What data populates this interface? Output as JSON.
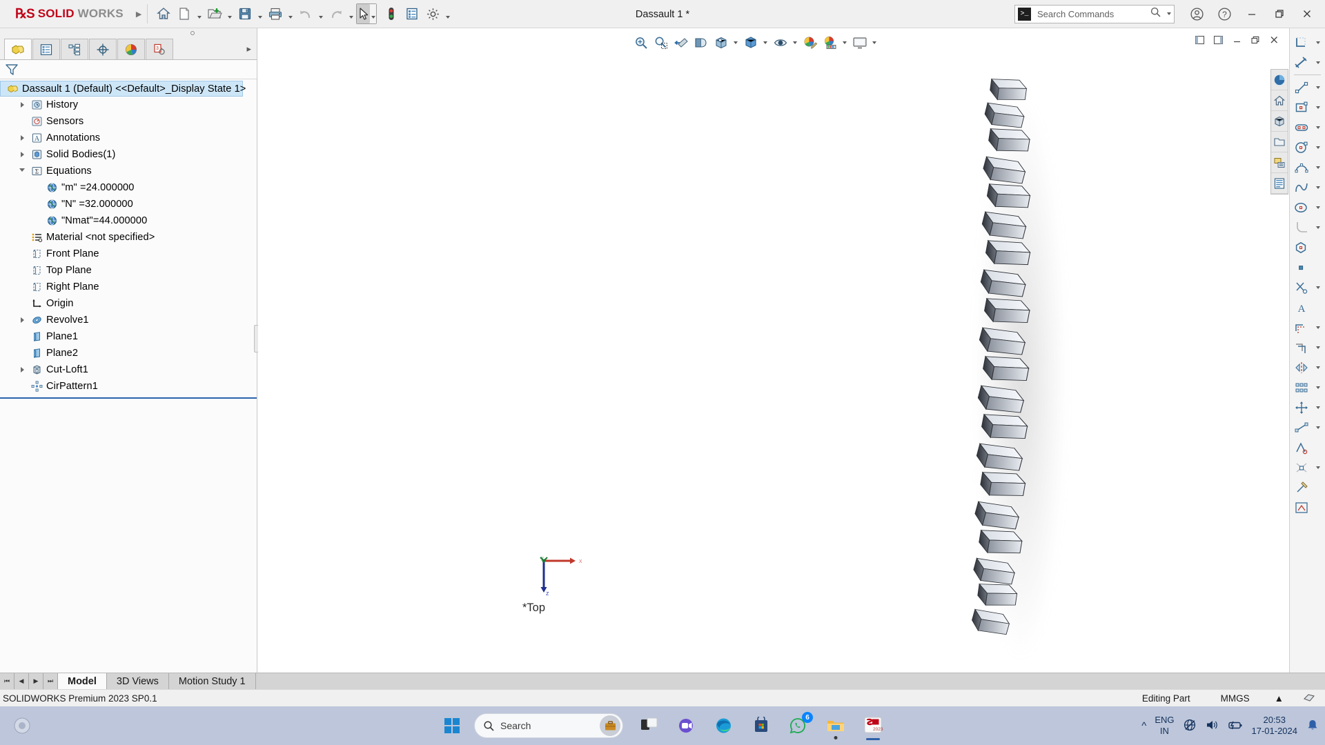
{
  "app": {
    "brand_ds": "2S",
    "brand_solid": "SOLID",
    "brand_works": "WORKS",
    "document_title": "Dassault 1 *",
    "version_text": "SOLIDWORKS Premium 2023 SP0.1"
  },
  "titlebar": {
    "buttons": [
      {
        "name": "home-button",
        "label": "Home"
      },
      {
        "name": "new-document-button",
        "label": "New"
      },
      {
        "name": "open-document-button",
        "label": "Open"
      },
      {
        "name": "save-button",
        "label": "Save"
      },
      {
        "name": "print-button",
        "label": "Print"
      },
      {
        "name": "undo-button",
        "label": "Undo"
      },
      {
        "name": "redo-button",
        "label": "Redo"
      },
      {
        "name": "select-button",
        "label": "Select"
      },
      {
        "name": "rebuild-button",
        "label": "Rebuild"
      },
      {
        "name": "file-properties-button",
        "label": "File Properties"
      },
      {
        "name": "options-button",
        "label": "Options"
      }
    ],
    "search": {
      "placeholder": "Search Commands",
      "value": "Search Commands"
    },
    "window_controls": {
      "account_label": "Account",
      "help_label": "Help",
      "minimize_label": "Minimize",
      "restore_label": "Restore",
      "close_label": "Close"
    }
  },
  "panel": {
    "tabs": [
      {
        "name": "feature-manager-tab",
        "label": "FeatureManager Design Tree",
        "selected": true
      },
      {
        "name": "property-manager-tab",
        "label": "PropertyManager",
        "selected": false
      },
      {
        "name": "configuration-manager-tab",
        "label": "ConfigurationManager",
        "selected": false
      },
      {
        "name": "dimxpert-manager-tab",
        "label": "DimXpertManager",
        "selected": false
      },
      {
        "name": "display-manager-tab",
        "label": "DisplayManager",
        "selected": false
      },
      {
        "name": "cam-feature-tree-tab",
        "label": "CAM Feature Tree",
        "selected": false
      }
    ],
    "filter_placeholder": "Filter",
    "tree": [
      {
        "label": "Dassault 1 (Default) <<Default>_Display State 1>",
        "icon": "part-icon",
        "indent": 0,
        "arrow": "none",
        "selected": true
      },
      {
        "label": "History",
        "icon": "history-icon",
        "indent": 1,
        "arrow": "collapsed",
        "selected": false
      },
      {
        "label": "Sensors",
        "icon": "sensors-icon",
        "indent": 1,
        "arrow": "none",
        "selected": false
      },
      {
        "label": "Annotations",
        "icon": "annotations-icon",
        "indent": 1,
        "arrow": "collapsed",
        "selected": false
      },
      {
        "label": "Solid Bodies(1)",
        "icon": "solid-bodies-icon",
        "indent": 1,
        "arrow": "collapsed",
        "selected": false
      },
      {
        "label": "Equations",
        "icon": "equations-icon",
        "indent": 1,
        "arrow": "expanded",
        "selected": false
      },
      {
        "label": "\"m\" =24.000000",
        "icon": "global-variable-icon",
        "indent": 2,
        "arrow": "none",
        "selected": false
      },
      {
        "label": "\"N\" =32.000000",
        "icon": "global-variable-icon",
        "indent": 2,
        "arrow": "none",
        "selected": false
      },
      {
        "label": "\"Nmat\"=44.000000",
        "icon": "global-variable-icon",
        "indent": 2,
        "arrow": "none",
        "selected": false
      },
      {
        "label": "Material <not specified>",
        "icon": "material-icon",
        "indent": 1,
        "arrow": "none",
        "selected": false
      },
      {
        "label": "Front Plane",
        "icon": "plane-icon",
        "indent": 1,
        "arrow": "none",
        "selected": false
      },
      {
        "label": "Top Plane",
        "icon": "plane-icon",
        "indent": 1,
        "arrow": "none",
        "selected": false
      },
      {
        "label": "Right Plane",
        "icon": "plane-icon",
        "indent": 1,
        "arrow": "none",
        "selected": false
      },
      {
        "label": "Origin",
        "icon": "origin-icon",
        "indent": 1,
        "arrow": "none",
        "selected": false
      },
      {
        "label": "Revolve1",
        "icon": "revolve-icon",
        "indent": 1,
        "arrow": "collapsed",
        "selected": false
      },
      {
        "label": "Plane1",
        "icon": "plane-blue-icon",
        "indent": 1,
        "arrow": "none",
        "selected": false
      },
      {
        "label": "Plane2",
        "icon": "plane-blue-icon",
        "indent": 1,
        "arrow": "none",
        "selected": false
      },
      {
        "label": "Cut-Loft1",
        "icon": "cut-loft-icon",
        "indent": 1,
        "arrow": "collapsed",
        "selected": false
      },
      {
        "label": "CirPattern1",
        "icon": "circular-pattern-icon",
        "indent": 1,
        "arrow": "none",
        "selected": false
      }
    ]
  },
  "viewtoolbar": {
    "buttons": [
      {
        "name": "zoom-to-fit-button",
        "label": "Zoom to Fit"
      },
      {
        "name": "zoom-to-area-button",
        "label": "Zoom to Area"
      },
      {
        "name": "previous-view-button",
        "label": "Previous View"
      },
      {
        "name": "section-view-button",
        "label": "Section View"
      },
      {
        "name": "view-orientation-button",
        "label": "View Orientation"
      },
      {
        "name": "display-style-button",
        "label": "Display Style"
      },
      {
        "name": "hide-show-items-button",
        "label": "Hide/Show Items"
      },
      {
        "name": "edit-appearance-button",
        "label": "Edit Appearance"
      },
      {
        "name": "apply-scene-button",
        "label": "Apply Scene"
      },
      {
        "name": "view-settings-button",
        "label": "View Settings"
      }
    ]
  },
  "graphics": {
    "view_label": "*Top",
    "triad": {
      "x": "x",
      "y": "y",
      "z": "z"
    }
  },
  "commandbar": {
    "items": [
      {
        "name": "sketch-tool-icon",
        "label": "Sketch"
      },
      {
        "name": "smart-dimension-icon",
        "label": "Smart Dimension"
      },
      {
        "name": "line-icon",
        "label": "Line"
      },
      {
        "name": "corner-rectangle-icon",
        "label": "Corner Rectangle"
      },
      {
        "name": "slot-icon",
        "label": "Straight Slot"
      },
      {
        "name": "circle-icon",
        "label": "Circle"
      },
      {
        "name": "centerpoint-arc-icon",
        "label": "Centerpoint Arc"
      },
      {
        "name": "spline-icon",
        "label": "Spline"
      },
      {
        "name": "ellipse-icon",
        "label": "Ellipse"
      },
      {
        "name": "sketch-fillet-icon",
        "label": "Sketch Fillet"
      },
      {
        "name": "polygon-icon",
        "label": "Polygon"
      },
      {
        "name": "point-icon",
        "label": "Point"
      },
      {
        "name": "trim-entities-icon",
        "label": "Trim Entities"
      },
      {
        "name": "text-icon",
        "label": "Text"
      },
      {
        "name": "offset-entities-icon",
        "label": "Offset Entities"
      },
      {
        "name": "convert-entities-icon",
        "label": "Convert Entities"
      },
      {
        "name": "mirror-entities-icon",
        "label": "Mirror Entities"
      },
      {
        "name": "linear-sketch-pattern-icon",
        "label": "Linear Sketch Pattern"
      },
      {
        "name": "move-entities-icon",
        "label": "Move Entities"
      },
      {
        "name": "display-delete-relations-icon",
        "label": "Display/Delete Relations"
      },
      {
        "name": "repair-sketch-icon",
        "label": "Repair Sketch"
      },
      {
        "name": "quick-snaps-icon",
        "label": "Quick Snaps"
      },
      {
        "name": "rapid-sketch-icon",
        "label": "Rapid Sketch"
      },
      {
        "name": "instant2d-icon",
        "label": "Instant2D"
      }
    ]
  },
  "vtabs": {
    "items": [
      {
        "name": "view-palette-tab",
        "label": "View Palette"
      },
      {
        "name": "appearances-tab",
        "label": "Appearances, Scenes and Decals"
      },
      {
        "name": "design-library-tab",
        "label": "Design Library"
      },
      {
        "name": "file-explorer-tab",
        "label": "File Explorer"
      },
      {
        "name": "search-tab",
        "label": "Search"
      },
      {
        "name": "custom-properties-tab",
        "label": "Custom Properties"
      }
    ]
  },
  "bottom": {
    "nav": [
      "first",
      "previous",
      "next",
      "last"
    ],
    "tabs": [
      {
        "name": "tab-model",
        "label": "Model",
        "selected": true
      },
      {
        "name": "tab-3d-views",
        "label": "3D Views",
        "selected": false
      },
      {
        "name": "tab-motion-study",
        "label": "Motion Study 1",
        "selected": false
      }
    ]
  },
  "status": {
    "left": "SOLIDWORKS Premium 2023 SP0.1",
    "editing": "Editing Part",
    "units": "MMGS"
  },
  "taskbar": {
    "search_placeholder": "Search",
    "items": [
      {
        "name": "start-button",
        "label": "Start"
      },
      {
        "name": "task-view-button",
        "label": "Task View"
      },
      {
        "name": "teams-button",
        "label": "Microsoft Teams"
      },
      {
        "name": "edge-button",
        "label": "Microsoft Edge"
      },
      {
        "name": "store-button",
        "label": "Microsoft Store"
      },
      {
        "name": "whatsapp-button",
        "label": "WhatsApp",
        "badge": "6"
      },
      {
        "name": "file-explorer-button",
        "label": "File Explorer"
      },
      {
        "name": "solidworks-taskbar-button",
        "label": "SOLIDWORKS 2023"
      }
    ],
    "tray": {
      "show_hidden_label": "Show hidden icons",
      "language_top": "ENG",
      "language_bottom": "IN",
      "network_label": "Network",
      "volume_label": "Volume",
      "battery_label": "Battery",
      "time": "20:53",
      "date": "17-01-2024",
      "notifications_label": "Notifications"
    }
  },
  "colors": {
    "brand_red": "#c00418",
    "selection_blue": "#cde6f7",
    "tree_divider": "#2a63ad",
    "taskbar_bg": "#bdc6da"
  }
}
